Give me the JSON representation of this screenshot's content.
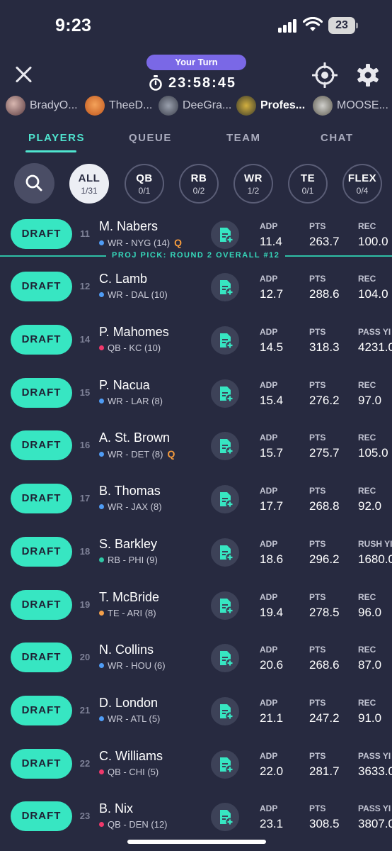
{
  "status": {
    "time": "9:23",
    "battery": "23"
  },
  "header": {
    "turn_label": "Your Turn",
    "timer": "23:58:45"
  },
  "teams": [
    {
      "name": "BradyO...",
      "active": false
    },
    {
      "name": "TheeD...",
      "active": false
    },
    {
      "name": "DeeGra...",
      "active": false
    },
    {
      "name": "Profes...",
      "active": true
    },
    {
      "name": "MOOSE...",
      "active": false
    }
  ],
  "tabs": [
    "PLAYERS",
    "QUEUE",
    "TEAM",
    "CHAT"
  ],
  "filters": [
    {
      "label": "ALL",
      "count": "1/31"
    },
    {
      "label": "QB",
      "count": "0/1"
    },
    {
      "label": "RB",
      "count": "0/2"
    },
    {
      "label": "WR",
      "count": "1/2"
    },
    {
      "label": "TE",
      "count": "0/1"
    },
    {
      "label": "FLEX",
      "count": "0/4"
    }
  ],
  "draft_label": "DRAFT",
  "projection": "PROJ PICK: ROUND 2 OVERALL #12",
  "colors": {
    "accent": "#37e6c2",
    "WR": "#4f9cf5",
    "QB": "#f0386b",
    "RB": "#2fc7a5",
    "TE": "#f5a04a",
    "Q": "#f59b3d"
  },
  "players": [
    {
      "rank": "11",
      "name": "M. Nabers",
      "pos": "WR",
      "meta": "WR - NYG (14)",
      "q": "Q",
      "stats": [
        {
          "label": "ADP",
          "value": "11.4"
        },
        {
          "label": "PTS",
          "value": "263.7"
        },
        {
          "label": "REC",
          "value": "100.0"
        }
      ]
    },
    {
      "rank": "12",
      "name": "C. Lamb",
      "pos": "WR",
      "meta": "WR - DAL (10)",
      "q": "",
      "stats": [
        {
          "label": "ADP",
          "value": "12.7"
        },
        {
          "label": "PTS",
          "value": "288.6"
        },
        {
          "label": "REC",
          "value": "104.0"
        }
      ]
    },
    {
      "rank": "14",
      "name": "P. Mahomes",
      "pos": "QB",
      "meta": "QB - KC (10)",
      "q": "",
      "stats": [
        {
          "label": "ADP",
          "value": "14.5"
        },
        {
          "label": "PTS",
          "value": "318.3"
        },
        {
          "label": "PASS YI",
          "value": "4231.0"
        }
      ]
    },
    {
      "rank": "15",
      "name": "P. Nacua",
      "pos": "WR",
      "meta": "WR - LAR (8)",
      "q": "",
      "stats": [
        {
          "label": "ADP",
          "value": "15.4"
        },
        {
          "label": "PTS",
          "value": "276.2"
        },
        {
          "label": "REC",
          "value": "97.0"
        }
      ]
    },
    {
      "rank": "16",
      "name": "A. St. Brown",
      "pos": "WR",
      "meta": "WR - DET (8)",
      "q": "Q",
      "stats": [
        {
          "label": "ADP",
          "value": "15.7"
        },
        {
          "label": "PTS",
          "value": "275.7"
        },
        {
          "label": "REC",
          "value": "105.0"
        }
      ]
    },
    {
      "rank": "17",
      "name": "B. Thomas",
      "pos": "WR",
      "meta": "WR - JAX (8)",
      "q": "",
      "stats": [
        {
          "label": "ADP",
          "value": "17.7"
        },
        {
          "label": "PTS",
          "value": "268.8"
        },
        {
          "label": "REC",
          "value": "92.0"
        }
      ]
    },
    {
      "rank": "18",
      "name": "S. Barkley",
      "pos": "RB",
      "meta": "RB - PHI (9)",
      "q": "",
      "stats": [
        {
          "label": "ADP",
          "value": "18.6"
        },
        {
          "label": "PTS",
          "value": "296.2"
        },
        {
          "label": "RUSH YI",
          "value": "1680.0"
        }
      ]
    },
    {
      "rank": "19",
      "name": "T. McBride",
      "pos": "TE",
      "meta": "TE - ARI (8)",
      "q": "",
      "stats": [
        {
          "label": "ADP",
          "value": "19.4"
        },
        {
          "label": "PTS",
          "value": "278.5"
        },
        {
          "label": "REC",
          "value": "96.0"
        }
      ]
    },
    {
      "rank": "20",
      "name": "N. Collins",
      "pos": "WR",
      "meta": "WR - HOU (6)",
      "q": "",
      "stats": [
        {
          "label": "ADP",
          "value": "20.6"
        },
        {
          "label": "PTS",
          "value": "268.6"
        },
        {
          "label": "REC",
          "value": "87.0"
        }
      ]
    },
    {
      "rank": "21",
      "name": "D. London",
      "pos": "WR",
      "meta": "WR - ATL (5)",
      "q": "",
      "stats": [
        {
          "label": "ADP",
          "value": "21.1"
        },
        {
          "label": "PTS",
          "value": "247.2"
        },
        {
          "label": "REC",
          "value": "91.0"
        }
      ]
    },
    {
      "rank": "22",
      "name": "C. Williams",
      "pos": "QB",
      "meta": "QB - CHI (5)",
      "q": "",
      "stats": [
        {
          "label": "ADP",
          "value": "22.0"
        },
        {
          "label": "PTS",
          "value": "281.7"
        },
        {
          "label": "PASS YI",
          "value": "3633.0"
        }
      ]
    },
    {
      "rank": "23",
      "name": "B. Nix",
      "pos": "QB",
      "meta": "QB - DEN (12)",
      "q": "",
      "stats": [
        {
          "label": "ADP",
          "value": "23.1"
        },
        {
          "label": "PTS",
          "value": "308.5"
        },
        {
          "label": "PASS YI",
          "value": "3807.0"
        }
      ]
    }
  ]
}
